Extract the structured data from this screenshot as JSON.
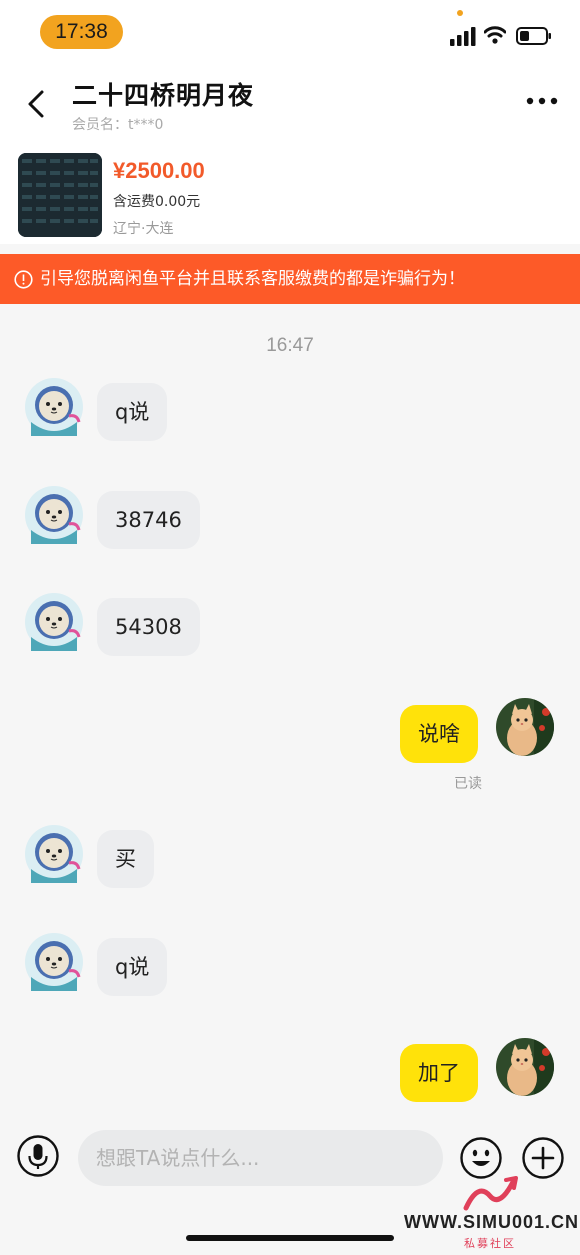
{
  "status_bar": {
    "time": "17:38"
  },
  "header": {
    "title": "二十四桥明月夜",
    "member": "会员名：t***0"
  },
  "product": {
    "price": "¥2500.00",
    "shipping": "含运费0.00元",
    "location": "辽宁·大连"
  },
  "warning": {
    "text": "引导您脱离闲鱼平台并且联系客服缴费的都是诈骗行为！"
  },
  "chat": {
    "timestamp": "16:47",
    "messages": [
      {
        "side": "in",
        "text": "q说"
      },
      {
        "side": "in",
        "text": "38746"
      },
      {
        "side": "in",
        "text": "54308"
      },
      {
        "side": "out",
        "text": "说啥"
      },
      {
        "side": "in",
        "text": "买"
      },
      {
        "side": "in",
        "text": "q说"
      },
      {
        "side": "out",
        "text": "加了"
      }
    ],
    "read_label": "已读"
  },
  "input": {
    "placeholder": "想跟TA说点什么..."
  },
  "watermark": {
    "url": "WWW.SIMU001.CN",
    "cn": "私募社区"
  },
  "colors": {
    "accent_orange": "#fd5a28",
    "price": "#f25a2a",
    "bubble_out": "#ffe20a",
    "bubble_in": "#ecedef",
    "time_pill": "#f2a31f"
  }
}
